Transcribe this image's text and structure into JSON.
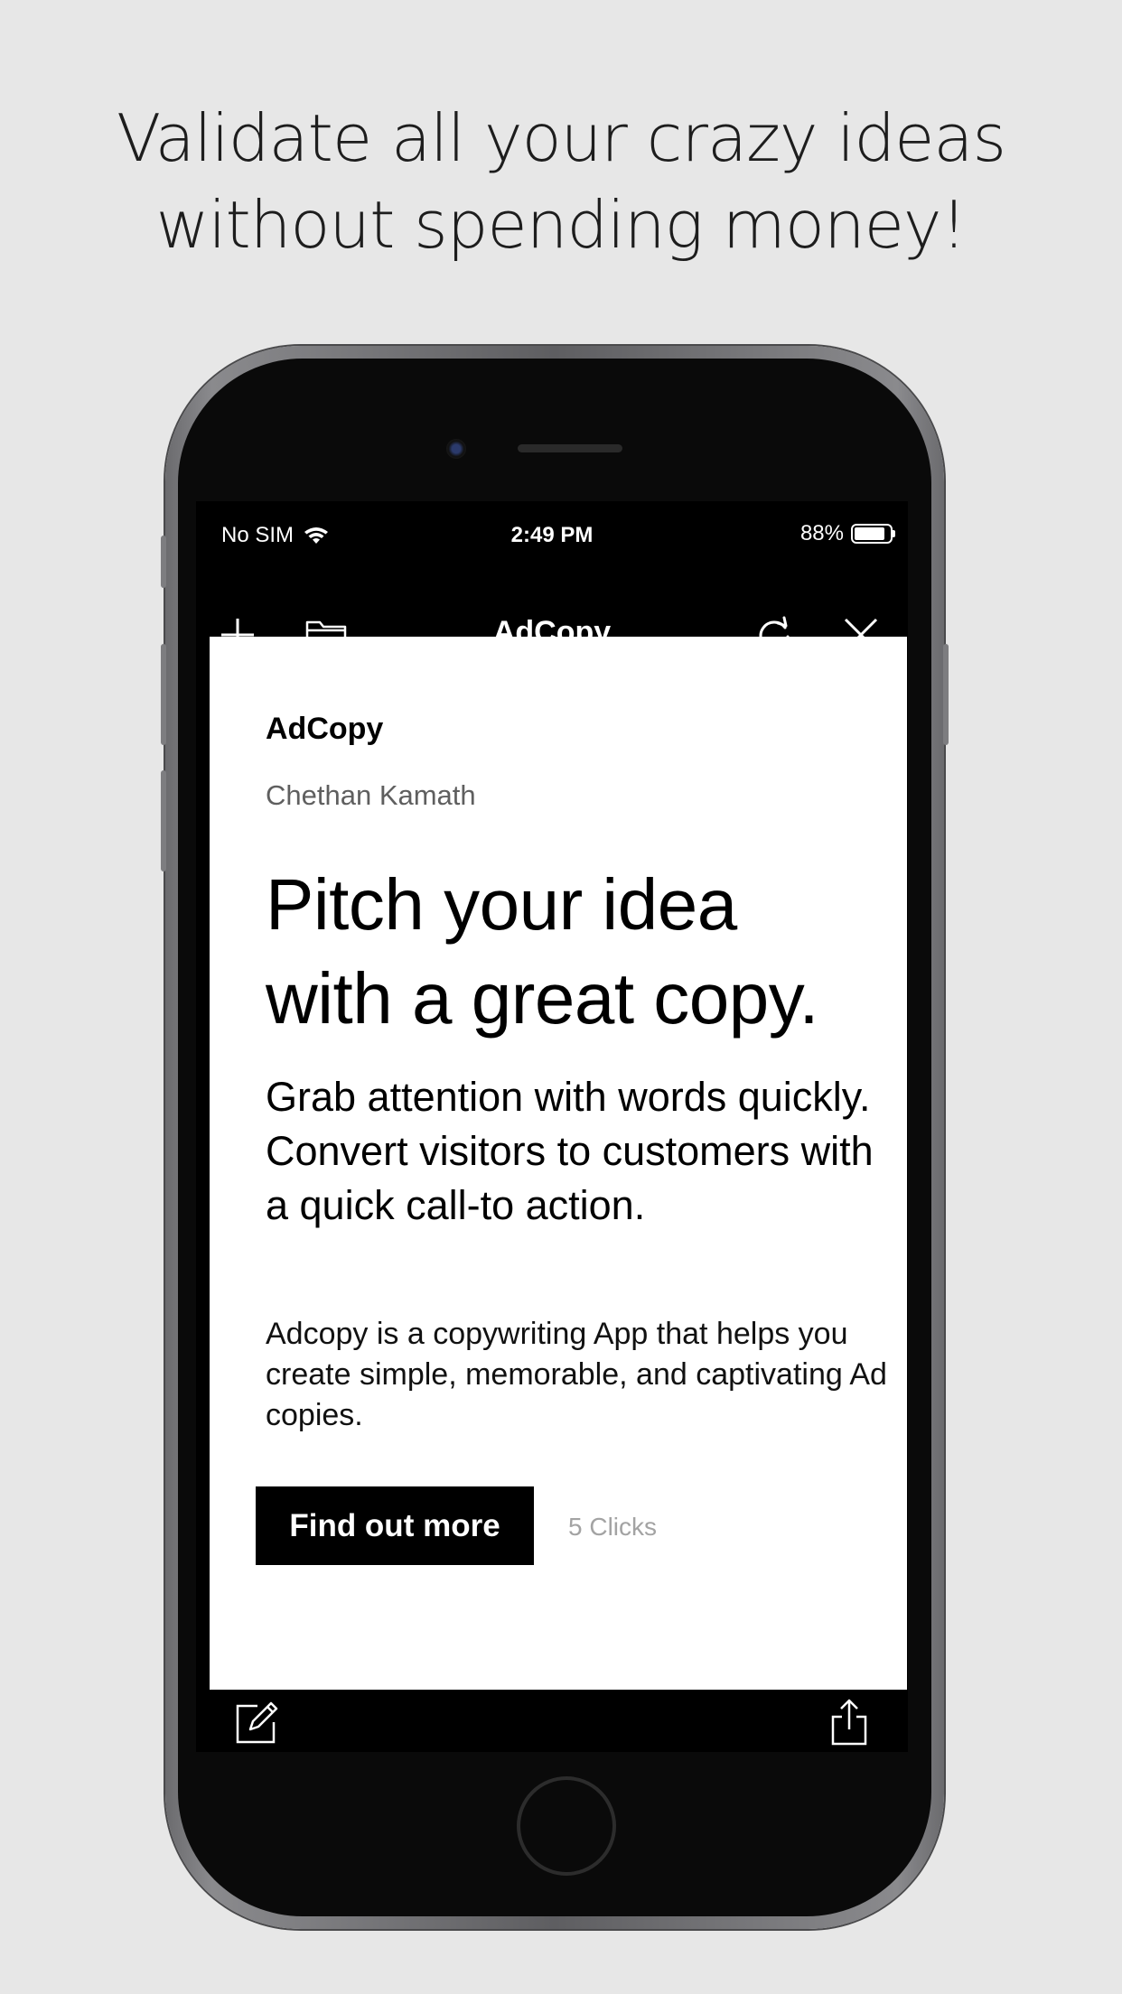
{
  "promo": {
    "headline_line1": "Validate all your crazy ideas",
    "headline_line2": "without spending money!"
  },
  "status_bar": {
    "carrier": "No SIM",
    "time": "2:49 PM",
    "battery_percent": "88%",
    "battery_level": 0.88,
    "wifi_icon": "wifi-icon",
    "battery_icon": "battery-icon"
  },
  "nav_bar": {
    "title": "AdCopy",
    "icons": [
      "plus-icon",
      "folder-icon",
      "refresh-icon",
      "close-icon"
    ]
  },
  "content": {
    "app_name": "AdCopy",
    "author": "Chethan Kamath",
    "pitch_line1": "Pitch your idea",
    "pitch_line2": "with a great copy.",
    "subheadline": "Grab attention with words quickly. Convert visitors to customers with a quick call-to action.",
    "description": "Adcopy is a copywriting App that helps you create simple, memorable, and captivating Ad copies.",
    "cta_label": "Find out more",
    "clicks": "5 Clicks"
  },
  "toolbar": {
    "icons": [
      "edit-icon",
      "share-icon"
    ]
  },
  "colors": {
    "background": "#e7e7e7",
    "screen_chrome": "#000000",
    "content_bg": "#ffffff",
    "cta_bg": "#000000"
  }
}
